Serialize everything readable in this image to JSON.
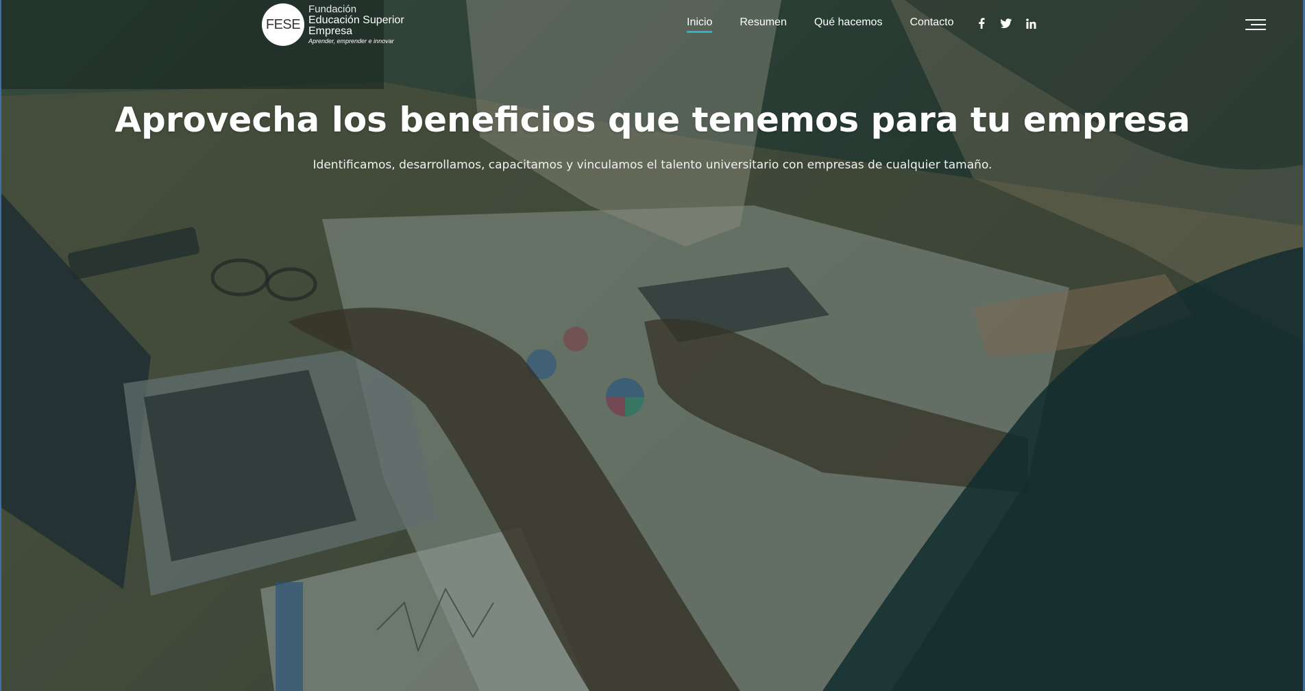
{
  "header": {
    "logo": {
      "mark": "FESE",
      "line1": "Fundación",
      "line2": "Educación Superior",
      "line3": "Empresa",
      "tagline": "Aprender, emprender e innovar"
    },
    "nav": [
      {
        "label": "Inicio",
        "active": true
      },
      {
        "label": "Resumen",
        "active": false
      },
      {
        "label": "Qué hacemos",
        "active": false
      },
      {
        "label": "Contacto",
        "active": false
      }
    ],
    "social": [
      "facebook-icon",
      "twitter-icon",
      "linkedin-icon"
    ],
    "menu_icon": "hamburger-icon"
  },
  "hero": {
    "title": "Aprovecha los beneficios que tenemos para tu empresa",
    "subtitle": "Identificamos, desarrollamos, capacitamos y vinculamos el talento universitario con empresas de cualquier tamaño."
  },
  "colors": {
    "overlay": "#163028",
    "accent": "#2bb3c9",
    "text": "#ffffff"
  }
}
